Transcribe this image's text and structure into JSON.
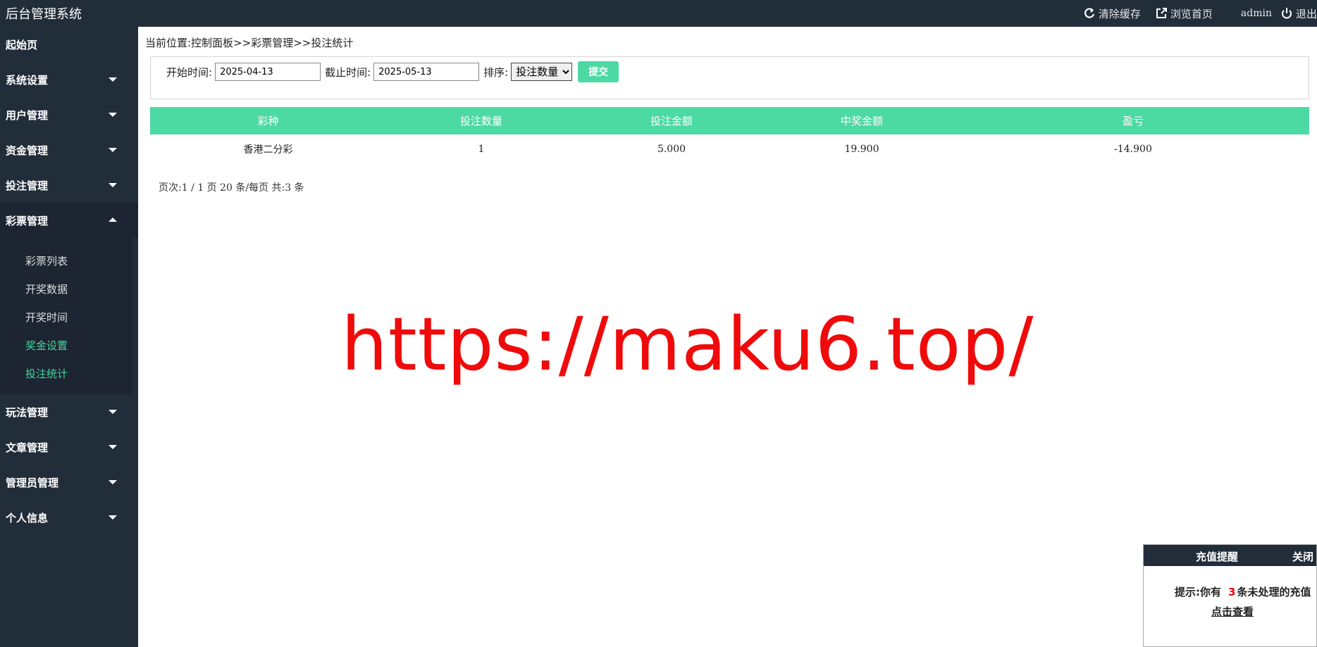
{
  "header": {
    "app_title": "后台管理系统",
    "clear_cache": "清除缓存",
    "browse_home": "浏览首页",
    "username": "admin",
    "logout": "退出"
  },
  "sidebar": {
    "home": "起始页",
    "items": [
      {
        "label": "系统设置"
      },
      {
        "label": "用户管理"
      },
      {
        "label": "资金管理"
      },
      {
        "label": "投注管理"
      },
      {
        "label": "彩票管理"
      },
      {
        "label": "玩法管理"
      },
      {
        "label": "文章管理"
      },
      {
        "label": "管理员管理"
      },
      {
        "label": "个人信息"
      }
    ],
    "lottery_sub": [
      {
        "label": "彩票列表"
      },
      {
        "label": "开奖数据"
      },
      {
        "label": "开奖时间"
      },
      {
        "label": "奖金设置"
      },
      {
        "label": "投注统计"
      }
    ]
  },
  "breadcrumb": "当前位置:控制面板>>彩票管理>>投注统计",
  "filter": {
    "start_label": "开始时间:",
    "start_value": "2025-04-13",
    "end_label": "截止时间:",
    "end_value": "2025-05-13",
    "sort_label": "排序:",
    "sort_selected": "投注数量",
    "submit": "提交"
  },
  "table": {
    "headers": [
      "彩种",
      "投注数量",
      "投注金额",
      "中奖金额",
      "盈亏"
    ],
    "rows": [
      [
        "香港二分彩",
        "1",
        "5.000",
        "19.900",
        "-14.900"
      ]
    ]
  },
  "pager": "页次:1 / 1 页 20 条/每页 共:3 条",
  "watermark": "https://maku6.top/",
  "popup": {
    "title": "充值提醒",
    "close": "关闭",
    "text_prefix": "提示:你有",
    "count": "3",
    "text_suffix": "条未处理的充值",
    "link": "点击查看"
  },
  "colors": {
    "sidebar_bg": "#222d3a",
    "accent": "#4cd9a3",
    "active_sub": "#48d6a0",
    "watermark": "#ef0b0b"
  }
}
